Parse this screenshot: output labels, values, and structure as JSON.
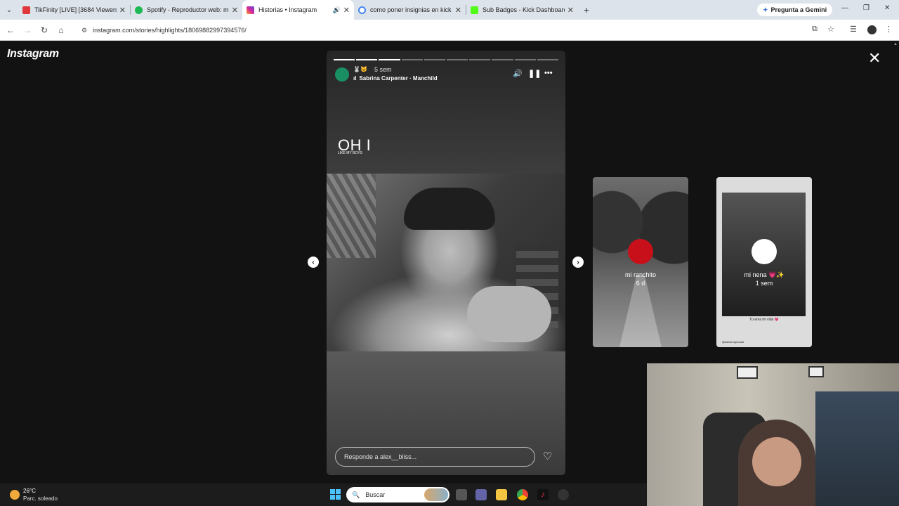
{
  "browser": {
    "tabs": [
      {
        "title": "TikFinity [LIVE] [3684 Viewers]",
        "color": "#e0373a"
      },
      {
        "title": "Spotify - Reproductor web: mús",
        "color": "#1db954"
      },
      {
        "title": "Historias • Instagram",
        "color": "#d6249f",
        "active": true
      },
      {
        "title": "como poner insignias en kick -",
        "color": "#4285f4"
      },
      {
        "title": "Sub Badges - Kick Dashboard",
        "color": "#53fc18"
      }
    ],
    "gemini_label": "Pregunta a Gemini",
    "url": "instagram.com/stories/highlights/18069882997394576/"
  },
  "instagram": {
    "logo": "Instagram",
    "story": {
      "emojis": "🐰🐱",
      "time_ago": "5 sem",
      "song": "Sabrina Carpenter · Manchild",
      "overlay_big": "OH I",
      "overlay_small": "LIKE MY BOYS",
      "reply_placeholder": "Responde a alex__bliss...",
      "progress_total": 10,
      "progress_done": 3
    },
    "highlights": [
      {
        "name": "mi ranchito",
        "time": "6 d",
        "dot_color": "#c8101a"
      },
      {
        "name": "mi nena 💗✨",
        "time": "1 sem",
        "dot_color": "#ffffff",
        "caption": "Tú eres mi vida 💗",
        "footer": "@dabril.zupecast"
      }
    ]
  },
  "taskbar": {
    "temperature": "26°C",
    "condition": "Parc. soleado",
    "search_label": "Buscar"
  }
}
